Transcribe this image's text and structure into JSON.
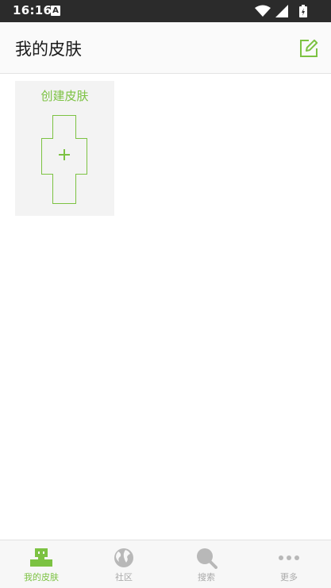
{
  "status_bar": {
    "time": "16:16",
    "notification_letter": "A"
  },
  "header": {
    "title": "我的皮肤",
    "edit_icon": "edit-square-icon"
  },
  "content": {
    "create_card_label": "创建皮肤",
    "create_icon": "plus-icon"
  },
  "bottom_nav": {
    "items": [
      {
        "label": "我的皮肤",
        "icon": "robot-icon",
        "active": true
      },
      {
        "label": "社区",
        "icon": "globe-icon",
        "active": false
      },
      {
        "label": "搜索",
        "icon": "search-icon",
        "active": false
      },
      {
        "label": "更多",
        "icon": "more-dots-icon",
        "active": false
      }
    ]
  },
  "colors": {
    "accent": "#7cc242",
    "inactive": "#aaaaaa",
    "status_bar": "#2b2b2b"
  }
}
